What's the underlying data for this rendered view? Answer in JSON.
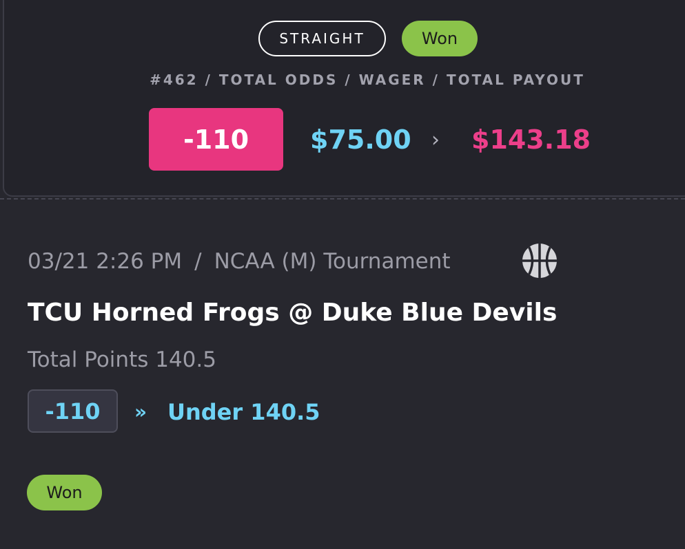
{
  "bet": {
    "type_label": "STRAIGHT",
    "status": "Won",
    "summary_label": "#462 / TOTAL ODDS / WAGER / TOTAL PAYOUT",
    "total_odds": "-110",
    "wager": "$75.00",
    "arrow": "›",
    "payout": "$143.18"
  },
  "leg": {
    "datetime": "03/21 2:26 PM",
    "separator": "/",
    "league": "NCAA (M) Tournament",
    "sport_icon": "basketball-icon",
    "matchup": "TCU Horned Frogs @ Duke Blue Devils",
    "market": "Total Points 140.5",
    "odds": "-110",
    "pick_arrow": "»",
    "pick": "Under 140.5",
    "status": "Won"
  },
  "colors": {
    "background": "#27272e",
    "odds_pink": "#e8367f",
    "wager_blue": "#6fd3f5",
    "payout_pink": "#ec3f8a",
    "won_green": "#8bc34a"
  }
}
